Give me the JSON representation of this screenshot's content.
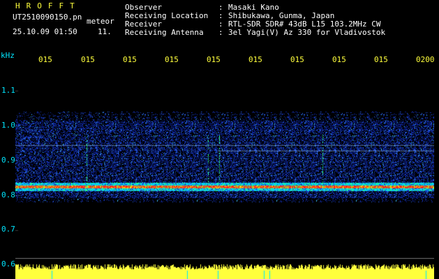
{
  "header": {
    "logo": "HROFFT",
    "filename": "UT2510090150.pn",
    "meteor_label": "meteor",
    "datetime": "25.10.09 01:50",
    "meteor_count": "11."
  },
  "station": {
    "rows": [
      {
        "label": "Observer",
        "colon": ":",
        "value": "Masaki Kano"
      },
      {
        "label": "Receiving Location",
        "colon": ":",
        "value": "Shibukawa, Gunma, Japan"
      },
      {
        "label": "Receiver",
        "colon": ":",
        "value": "RTL-SDR SDR# 43dB L15 103.2MHz CW"
      },
      {
        "label": "Receiving Antenna",
        "colon": ":",
        "value": "3el Yagi(V) Az 330 for Vladivostok"
      }
    ]
  },
  "axis": {
    "unit": "kHz",
    "time_ticks": [
      "015",
      "015",
      "015",
      "015",
      "015",
      "015",
      "015",
      "015",
      "015",
      "0200"
    ],
    "freq_ticks": [
      "1.1",
      "1.0",
      "0.9",
      "0.8",
      "0.7",
      "0.6"
    ]
  },
  "colors": {
    "background": "#000000",
    "label_cyan": "#00e6ff",
    "tick_yellow": "#ffff3c",
    "echo_red": "#ff2020",
    "noise_blue": "#1838c8"
  }
}
